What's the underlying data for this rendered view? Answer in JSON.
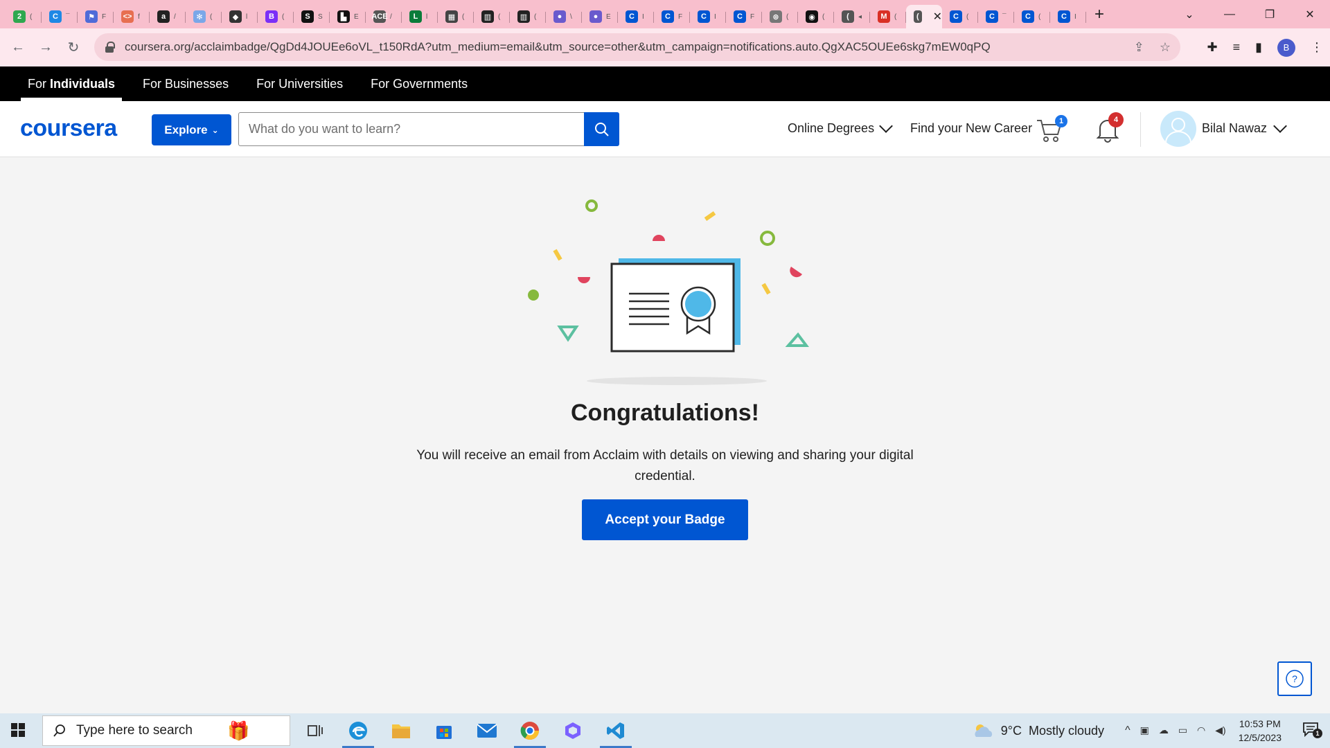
{
  "browser": {
    "tabs": [
      {
        "icon": "2",
        "color": "#2fa84f",
        "rest": "("
      },
      {
        "icon": "C",
        "color": "#1e88e5",
        "rest": "¯"
      },
      {
        "icon": "⚑",
        "color": "#4f6bd8",
        "rest": "F"
      },
      {
        "icon": "<>",
        "color": "#e76f51",
        "rest": "f"
      },
      {
        "icon": "a",
        "color": "#222222",
        "rest": "/"
      },
      {
        "icon": "✻",
        "color": "#7aa7e8",
        "rest": "("
      },
      {
        "icon": "◆",
        "color": "#333333",
        "rest": "l"
      },
      {
        "icon": "B",
        "color": "#7b2ff7",
        "rest": "("
      },
      {
        "icon": "S",
        "color": "#111111",
        "rest": "S"
      },
      {
        "icon": "▙",
        "color": "#111111",
        "rest": "E"
      },
      {
        "icon": "ACE",
        "color": "#555555",
        "rest": "/"
      },
      {
        "icon": "L",
        "color": "#0a7c3a",
        "rest": "l"
      },
      {
        "icon": "▦",
        "color": "#444444",
        "rest": "("
      },
      {
        "icon": "▥",
        "color": "#222222",
        "rest": "("
      },
      {
        "icon": "▥",
        "color": "#222222",
        "rest": "("
      },
      {
        "icon": "●",
        "color": "#6a5acd",
        "rest": "\\"
      },
      {
        "icon": "●",
        "color": "#6a5acd",
        "rest": "E"
      },
      {
        "icon": "C",
        "color": "#0056d2",
        "rest": "I"
      },
      {
        "icon": "C",
        "color": "#0056d2",
        "rest": "F"
      },
      {
        "icon": "C",
        "color": "#0056d2",
        "rest": "I"
      },
      {
        "icon": "C",
        "color": "#0056d2",
        "rest": "F"
      },
      {
        "icon": "⊛",
        "color": "#777777",
        "rest": "("
      },
      {
        "icon": "◉",
        "color": "#111111",
        "rest": "("
      },
      {
        "icon": "(",
        "color": "#555555",
        "rest": "◂"
      },
      {
        "icon": "M",
        "color": "#d93025",
        "rest": "("
      },
      {
        "icon": "(",
        "color": "#555555",
        "rest": "",
        "active": true
      },
      {
        "icon": "C",
        "color": "#0056d2",
        "rest": "("
      },
      {
        "icon": "C",
        "color": "#0056d2",
        "rest": "¯"
      },
      {
        "icon": "C",
        "color": "#0056d2",
        "rest": "("
      },
      {
        "icon": "C",
        "color": "#0056d2",
        "rest": "I"
      }
    ],
    "url": "coursera.org/acclaimbadge/QgDd4JOUEe6oVL_t150RdA?utm_medium=email&utm_source=other&utm_campaign=notifications.auto.QgXAC5OUEe6skg7mEW0qPQ",
    "profile_initial": "B"
  },
  "segments": {
    "individuals_prefix": "For",
    "individuals_bold": "Individuals",
    "businesses": "For Businesses",
    "universities": "For Universities",
    "governments": "For Governments"
  },
  "header": {
    "logo": "coursera",
    "explore": "Explore",
    "search_placeholder": "What do you want to learn?",
    "online_degrees": "Online Degrees",
    "find_career": "Find your New Career",
    "cart_count": "1",
    "notif_count": "4",
    "user_name": "Bilal Nawaz"
  },
  "main": {
    "title": "Congratulations!",
    "message": "You will receive an email from Acclaim with details on viewing and sharing your digital credential.",
    "accept_button": "Accept your Badge"
  },
  "taskbar": {
    "search_placeholder": "Type here to search",
    "weather_temp": "9°C",
    "weather_desc": "Mostly cloudy",
    "time": "10:53 PM",
    "date": "12/5/2023",
    "notif_count": "1"
  },
  "colors": {
    "brand": "#0056d2",
    "tabstrip": "#f8bfcd",
    "toolbar": "#fde8ee",
    "taskbar": "#dbe8f1",
    "badge_cart": "#1a73e8",
    "badge_notif": "#d32f2f"
  }
}
